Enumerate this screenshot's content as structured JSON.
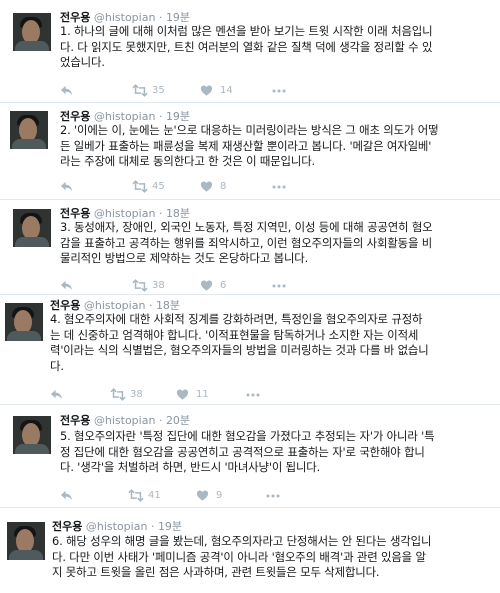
{
  "tweets": [
    {
      "name": "전우용",
      "handle": "@histopian",
      "time": "19분",
      "lines": [
        "1. 하나의 글에 대해 이처럼 많은 멘션을 받아 보기는 트윗 시작한 이래 처음입니",
        "다. 다 읽지도 못했지만, 트친 여러분의 열화 같은 질책 덕에 생각을 정리할 수 있",
        "었습니다."
      ],
      "retweets": "35",
      "likes": "14"
    },
    {
      "name": "전우용",
      "handle": "@histopian",
      "time": "19분",
      "lines": [
        "2. '이에는 이, 눈에는 눈'으로 대응하는 미러링이라는 방식은 그 애초 의도가 어떻",
        "든 일베가 표출하는 패륜성을 복제 재생산할 뿐이라고 봅니다. '메갈은 여자일베'",
        "라는 주장에 대체로 동의한다고 한 것은 이 때문입니다."
      ],
      "retweets": "45",
      "likes": "8"
    },
    {
      "name": "전우용",
      "handle": "@histopian",
      "time": "18분",
      "lines": [
        "3. 동성애자, 장애인, 외국인 노동자, 특정 지역민, 이성 등에 대해 공공연히 혐오",
        "감을 표출하고 공격하는 행위를 죄악시하고, 이런 혐오주의자들의 사회활동을 비",
        "물리적인 방법으로 제약하는 것도 온당하다고 봅니다."
      ],
      "retweets": "38",
      "likes": "6"
    },
    {
      "name": "전우용",
      "handle": "@histopian",
      "time": "18분",
      "lines": [
        "4. 혐오주의자에 대한 사회적 징계를 강화하려면, 특정인을 혐오주의자로 규정하",
        "는 데 신중하고 엄격해야 합니다. '이적표현물을 탐독하거나 소지한 자는 이적세",
        "력'이라는 식의 식별법은, 혐오주의자들의 방법을 미러링하는 것과 다를 바 없습니",
        "다."
      ],
      "retweets": "38",
      "likes": "11"
    },
    {
      "name": "전우용",
      "handle": "@histopian",
      "time": "20분",
      "lines": [
        "5. 혐오주의자란 '특정 집단에 대한 혐오감을 가졌다고 추정되는 자'가 아니라 '특",
        "정 집단에 대한 혐오감을 공공연히고 공격적으로 표출하는 자'로 국한해야 합니",
        "다. '생각'을 처벌하려 하면, 반드시 '마녀사냥'이 됩니다."
      ],
      "retweets": "41",
      "likes": "9"
    },
    {
      "name": "전우용",
      "handle": "@histopian",
      "time": "19분",
      "lines": [
        "6. 해당 성우의 해명 글을 봤는데, 혐오주의자라고 단정해서는 안 된다는 생각입니",
        "다. 다만 이번 사태가 '페미니즘 공격'이 아니라 '혐오주의 배격'과 관련 있음을 알",
        "지 못하고 트윗을 올린 점은 사과하며, 관련 트윗들은 모두 삭제합니다."
      ],
      "retweets": "",
      "likes": ""
    }
  ]
}
